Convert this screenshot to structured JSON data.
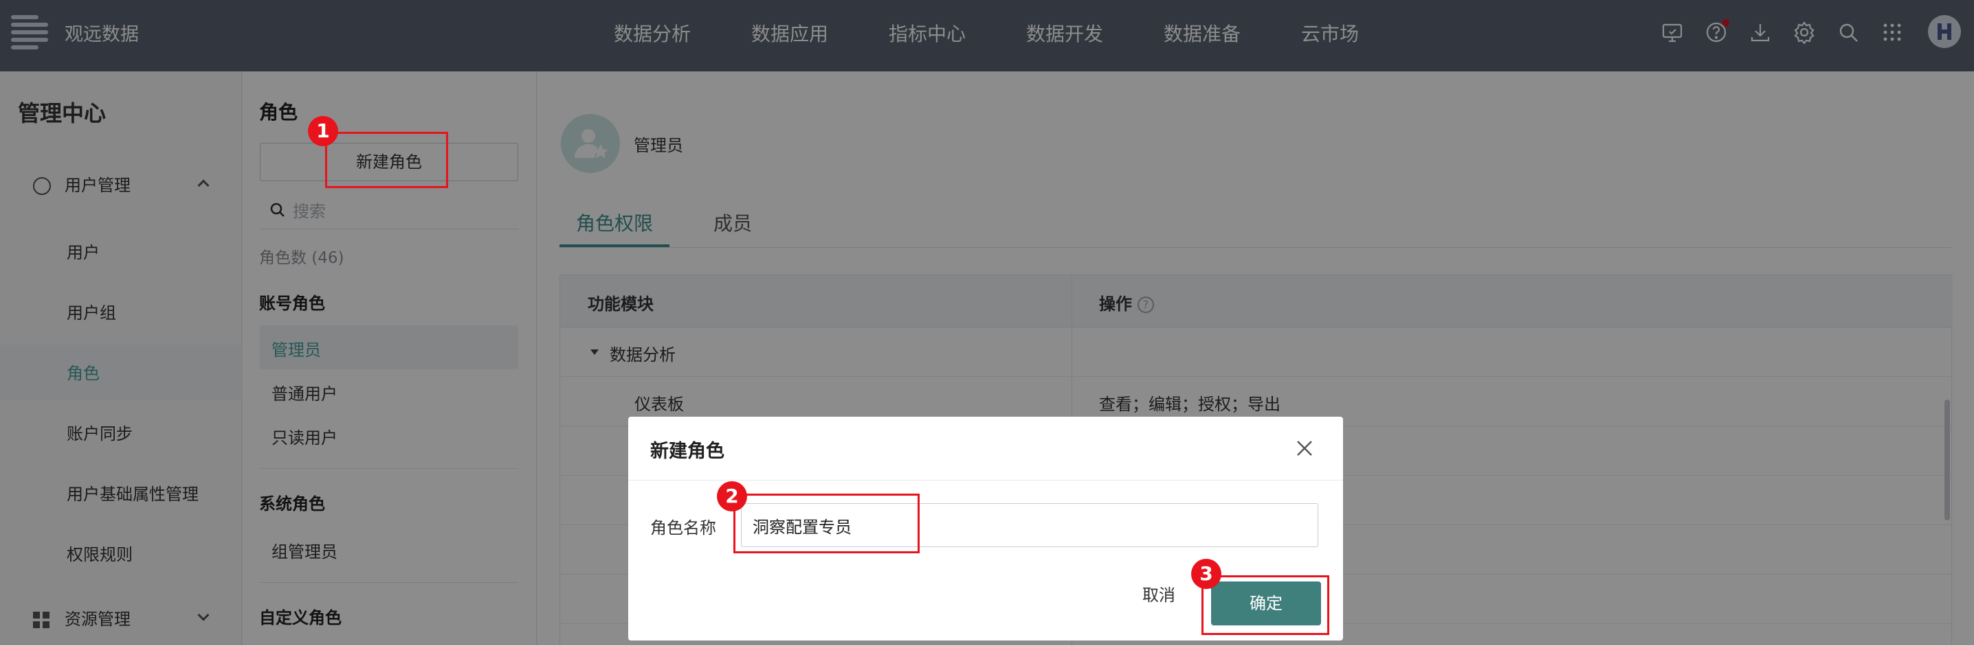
{
  "topbar": {
    "brand": "观远数据",
    "nav": [
      "数据分析",
      "数据应用",
      "指标中心",
      "数据开发",
      "数据准备",
      "云市场"
    ],
    "icons": [
      "screen-icon",
      "help-icon",
      "download-icon",
      "settings-icon",
      "search-icon",
      "apps-grid-icon"
    ],
    "notification_color": "#e8131c"
  },
  "sidebar": {
    "title": "管理中心",
    "group_user": "用户管理",
    "items": [
      "用户",
      "用户组",
      "角色",
      "账户同步",
      "用户基础属性管理",
      "权限规则"
    ],
    "active_item": "角色",
    "group_resource": "资源管理"
  },
  "roles": {
    "title": "角色",
    "new_button": "新建角色",
    "search_placeholder": "搜索",
    "count": "角色数 (46)",
    "section_account": "账号角色",
    "account_roles": [
      "管理员",
      "普通用户",
      "只读用户"
    ],
    "section_system": "系统角色",
    "system_roles": [
      "组管理员"
    ],
    "section_custom": "自定义角色"
  },
  "main": {
    "role_name": "管理员",
    "tabs": [
      "角色权限",
      "成员"
    ],
    "active_tab": "角色权限",
    "table": {
      "headers": [
        "功能模块",
        "操作"
      ],
      "help_glyph": "?",
      "rows": [
        {
          "module": "数据分析",
          "ops": ""
        },
        {
          "module": "仪表板",
          "ops": "查看；编辑；授权；导出"
        }
      ]
    }
  },
  "dialog": {
    "title": "新建角色",
    "name_label": "角色名称",
    "name_value": "洞察配置专员",
    "cancel": "取消",
    "ok": "确定"
  },
  "annotations": [
    "1",
    "2",
    "3"
  ],
  "colors": {
    "accent": "#3f7f7c",
    "annotation_red": "#e8131c",
    "topbar": "#5b6473"
  }
}
